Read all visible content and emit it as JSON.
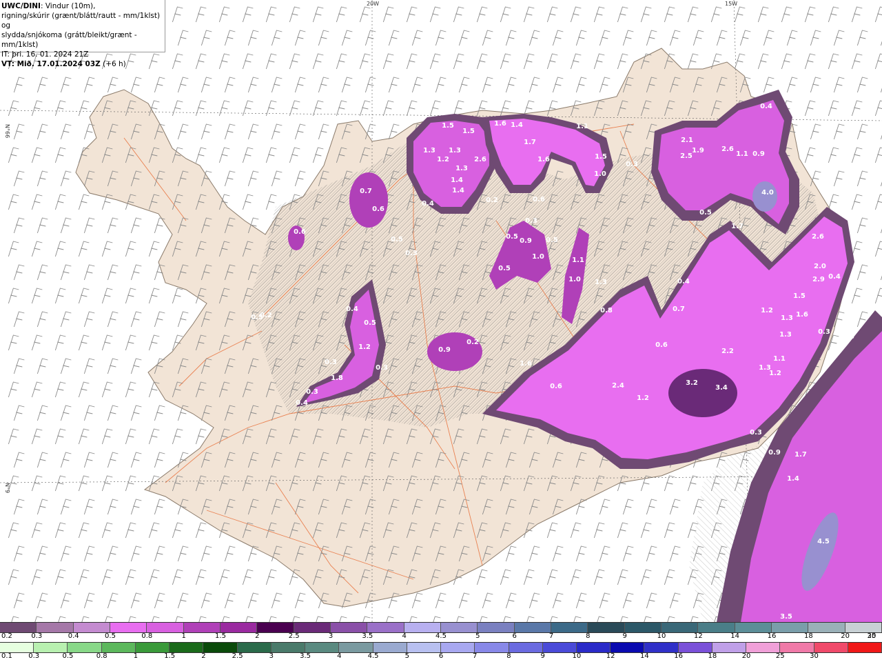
{
  "title": {
    "model": "UWC/DINI",
    "line1": ": Vindur (10m),",
    "line2": "rigning/skúrir (grænt/blátt/rautt - mm/1klst) og",
    "line3": "slydda/snjókoma (grátt/bleikt/grænt - mm/1klst)",
    "issue_time": "IT: þri. 16. 01. 2024 21Z",
    "valid_time": "VT: Mið. 17.01.2024 03Z",
    "lead_time": " (+6 h)"
  },
  "grid_labels": {
    "lon_20w": "20W",
    "lon_15w": "15W",
    "lat_66n": "N°66",
    "lat_65n": "N°9"
  },
  "map_values": [
    "1.5",
    "1.5",
    "1.6",
    "1.4",
    "1.1",
    "1.3",
    "1.3",
    "1.7",
    "1.2",
    "1.3",
    "2.6",
    "1.6",
    "1.4",
    "1.5",
    "0.3",
    "1.0",
    "1.4",
    "0.4",
    "0.2",
    "0.6",
    "0.7",
    "0.6",
    "0.6",
    "0.5",
    "0.3",
    "0.3",
    "0.9",
    "0.5",
    "0.5",
    "1.0",
    "0.5",
    "1.1",
    "1.0",
    "1.3",
    "2.1",
    "1.9",
    "2.6",
    "1.1",
    "0.9",
    "2.5",
    "0.4",
    "4.0",
    "0.5",
    "1.7",
    "2.6",
    "2.0",
    "2.9",
    "0.4",
    "0.4",
    "0.4",
    "0.5",
    "1.2",
    "0.9",
    "0.2",
    "0.3",
    "0.3",
    "0.4",
    "0.8",
    "0.7",
    "0.6",
    "1.2",
    "1.5",
    "1.6",
    "1.3",
    "1.3",
    "0.3",
    "2.8",
    "0.5",
    "1.8",
    "0.3",
    "0.4",
    "1.6",
    "0.6",
    "2.4",
    "1.2",
    "3.2",
    "3.4",
    "2.2",
    "1.1",
    "1.2",
    "1.3",
    "0.3",
    "0.9",
    "1.7",
    "1.4",
    "4.5",
    "3.5",
    "0.2",
    "0.6"
  ],
  "legend_snow": {
    "colors": [
      "#6f4a73",
      "#a578a8",
      "#c48bd0",
      "#e86ef0",
      "#d860e0",
      "#b040b8",
      "#9a2aa0",
      "#4a0050",
      "#6a2a78",
      "#8a50a8",
      "#9a70c8",
      "#b8b0f0",
      "#9890d0",
      "#7a80c0",
      "#5a78a8",
      "#3c6a88",
      "#2a4a58",
      "#2c5868",
      "#3a6878",
      "#4a7e88",
      "#5c8e98",
      "#7a9eaa",
      "#9ab0b8",
      "#c8d0d4"
    ],
    "labels": [
      "0.2",
      "0.3",
      "0.4",
      "0.5",
      "0.8",
      "1",
      "1.5",
      "2",
      "2.5",
      "3",
      "3.5",
      "4",
      "4.5",
      "5",
      "6",
      "7",
      "8",
      "9",
      "10",
      "12",
      "14",
      "16",
      "18",
      "20",
      "25",
      "30"
    ]
  },
  "legend_rain": {
    "colors": [
      "#e6ffe0",
      "#b8f0b0",
      "#88d888",
      "#5cb85c",
      "#3a9a3a",
      "#1a6a1a",
      "#0a4a0a",
      "#2a6a4a",
      "#4a7a6a",
      "#5a8a80",
      "#7a9aa0",
      "#9aaad0",
      "#b8c0f0",
      "#a8a8f0",
      "#8888e8",
      "#6a6ae0",
      "#4a4ad8",
      "#2a2ac8",
      "#0a0ab0",
      "#3030c8",
      "#7a50d8",
      "#c0a0e8",
      "#f0a0d8",
      "#f07aa8",
      "#f04a6a",
      "#f01818"
    ],
    "labels": [
      "0.1",
      "0.3",
      "0.5",
      "0.8",
      "1",
      "1.5",
      "2",
      "2.5",
      "3",
      "3.5",
      "4",
      "4.5",
      "5",
      "6",
      "7",
      "8",
      "9",
      "10",
      "12",
      "14",
      "16",
      "18",
      "20",
      "25",
      "30"
    ]
  },
  "colors": {
    "land": "#f2e4d6",
    "sea": "#ffffff",
    "roads": "#e8703a",
    "coast": "#8a7a6a",
    "hatch": "#666666"
  }
}
